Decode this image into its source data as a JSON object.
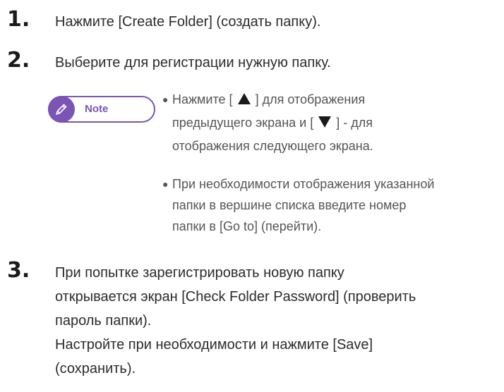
{
  "steps": [
    {
      "number": "1.",
      "text": "Нажмите [Create Folder] (создать папку)."
    },
    {
      "number": "2.",
      "text": "Выберите для регистрации нужную папку."
    },
    {
      "number": "3.",
      "lines": [
        "При попытке зарегистрировать новую папку",
        "открывается экран [Check Folder Password] (проверить",
        "пароль папки).",
        "Настройте при необходимости и нажмите [Save]",
        "(сохранить)."
      ]
    }
  ],
  "note": {
    "label": "Note",
    "icon": "pencil-icon",
    "accent_color": "#7a55b3",
    "bullets": [
      {
        "line1_prefix": "Нажмите [",
        "line1_suffix": "] для отображения",
        "line2_prefix": "предыдущего экрана и  [",
        "line2_suffix": "] - для",
        "line3": "отображения следующего экрана."
      },
      {
        "lines": [
          "При необходимости отображения указанной",
          "папки в вершине списка введите номер",
          "папки в [Go to] (перейти)."
        ]
      }
    ]
  }
}
